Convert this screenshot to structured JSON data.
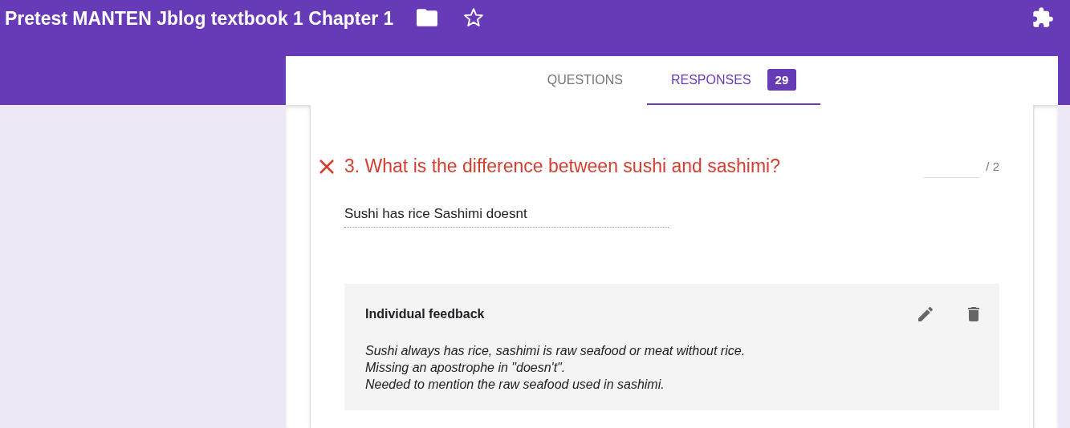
{
  "window": {
    "title": "Pretest MANTEN Jblog textbook 1 Chapter 1"
  },
  "tabs": [
    {
      "label": "QUESTIONS",
      "selected": false
    },
    {
      "label": "RESPONSES",
      "selected": true,
      "count": "29"
    }
  ],
  "question": {
    "title": "3. What is the difference between sushi and sashimi?",
    "correct": false,
    "score_max": "/ 2",
    "answer": "Sushi has rice Sashimi doesnt",
    "feedback": {
      "heading": "Individual feedback",
      "lines": [
        "Sushi always has rice, sashimi is raw seafood or meat without rice.",
        "Missing an apostrophe in \"doesn't\".",
        "Needed to mention the raw seafood used in sashimi."
      ]
    }
  }
}
